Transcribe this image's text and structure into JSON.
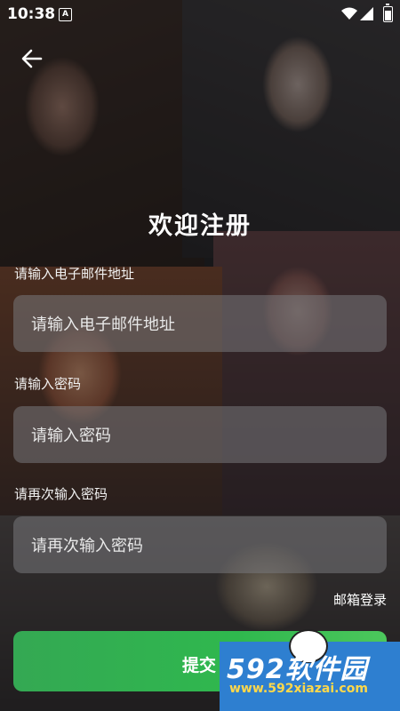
{
  "status_bar": {
    "time": "10:38",
    "notification_icon": "A"
  },
  "header": {
    "back_icon": "arrow-left-icon"
  },
  "title": "欢迎注册",
  "form": {
    "email": {
      "label": "请输入电子邮件地址",
      "placeholder": "请输入电子邮件地址",
      "value": ""
    },
    "password": {
      "label": "请输入密码",
      "placeholder": "请输入密码",
      "value": ""
    },
    "confirm_password": {
      "label": "请再次输入密码",
      "placeholder": "请再次输入密码",
      "value": ""
    }
  },
  "links": {
    "mail_login": "邮箱登录"
  },
  "buttons": {
    "submit": "提交"
  },
  "watermark": {
    "brand": "592软件园",
    "url": "www.592xiazai.com"
  },
  "colors": {
    "submit_button": "#34a853",
    "watermark_bg": "#2e7fd0",
    "watermark_url": "#ffd84a"
  }
}
